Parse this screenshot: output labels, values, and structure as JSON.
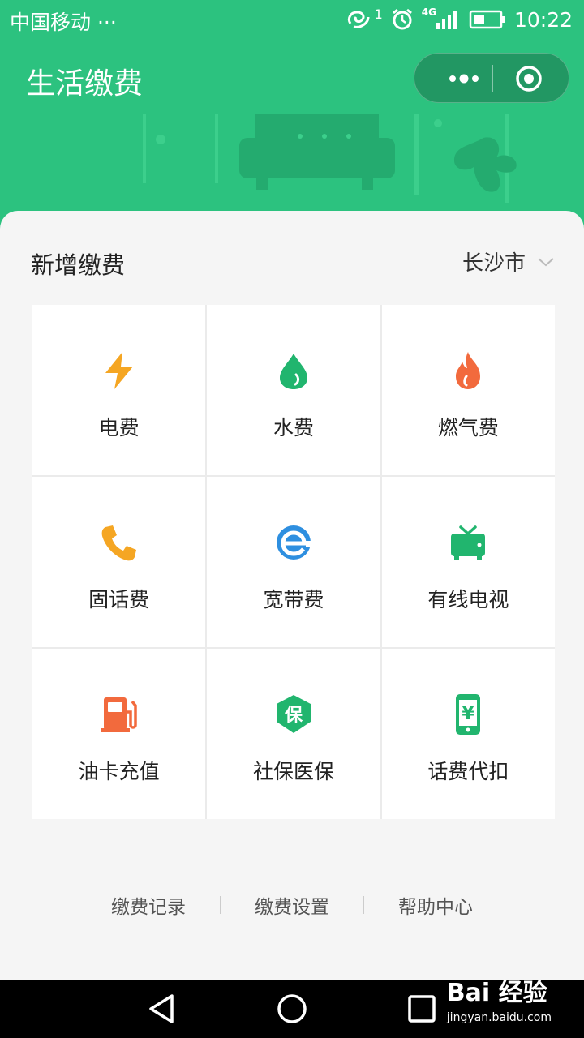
{
  "status_bar": {
    "carrier": "中国移动 ···",
    "time": "10:22",
    "net": "4G",
    "sim_index": "1"
  },
  "header": {
    "title": "生活缴费"
  },
  "section": {
    "title": "新增缴费",
    "city": "长沙市"
  },
  "services": [
    {
      "label": "电费",
      "icon": "lightning-icon",
      "color": "#f5a623"
    },
    {
      "label": "水费",
      "icon": "water-drop-icon",
      "color": "#21b56e"
    },
    {
      "label": "燃气费",
      "icon": "flame-icon",
      "color": "#f26a3d"
    },
    {
      "label": "固话费",
      "icon": "phone-icon",
      "color": "#f5a623"
    },
    {
      "label": "宽带费",
      "icon": "broadband-e-icon",
      "color": "#2e8fe0"
    },
    {
      "label": "有线电视",
      "icon": "tv-icon",
      "color": "#21b56e"
    },
    {
      "label": "油卡充值",
      "icon": "fuel-pump-icon",
      "color": "#f26a3d"
    },
    {
      "label": "社保医保",
      "icon": "insurance-shield-icon",
      "glyph": "保",
      "color": "#21b56e"
    },
    {
      "label": "话费代扣",
      "icon": "mobile-yuan-icon",
      "glyph": "¥",
      "color": "#21b56e"
    }
  ],
  "footer": {
    "links": [
      "缴费记录",
      "缴费设置",
      "帮助中心"
    ]
  },
  "watermark": {
    "brand": "Bai 经验",
    "url": "jingyan.baidu.com"
  },
  "colors": {
    "brand_green": "#2cc27f",
    "background": "#f5f5f5"
  }
}
